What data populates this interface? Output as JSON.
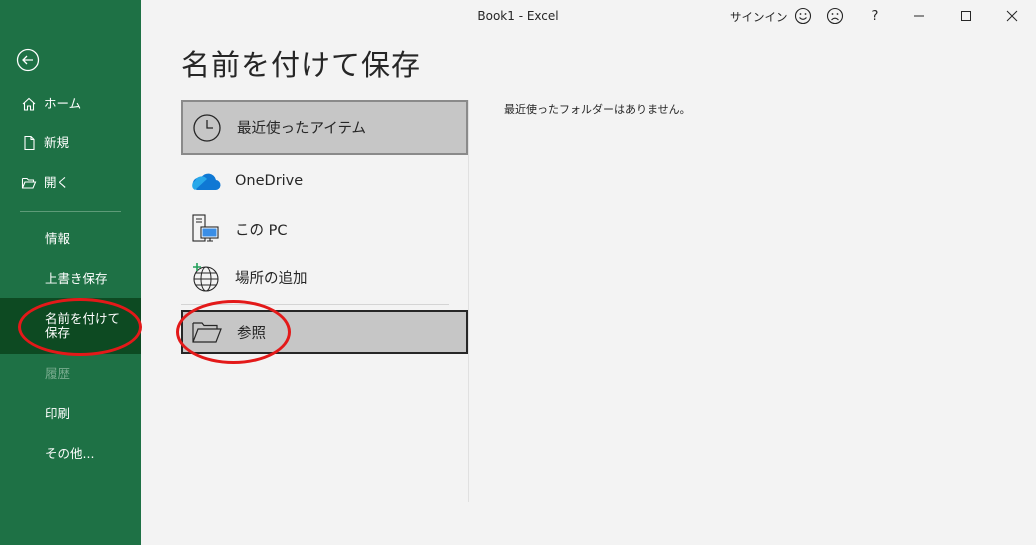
{
  "titlebar": {
    "title": "Book1  -  Excel",
    "signin": "サインイン",
    "icons": [
      "smiley-icon",
      "frown-icon",
      "help-icon",
      "minimize-icon",
      "maximize-icon",
      "close-icon"
    ],
    "help_label": "?"
  },
  "sidebar": {
    "items": [
      {
        "label": "ホーム",
        "icon": "home-icon"
      },
      {
        "label": "新規",
        "icon": "new-document-icon"
      },
      {
        "label": "開く",
        "icon": "open-folder-icon"
      },
      {
        "label": "情報"
      },
      {
        "label": "上書き保存"
      },
      {
        "label": "名前を付けて保存"
      },
      {
        "label": "履歴"
      },
      {
        "label": "印刷"
      },
      {
        "label": "その他..."
      }
    ]
  },
  "main": {
    "title": "名前を付けて保存",
    "locations": [
      {
        "label": "最近使ったアイテム",
        "icon": "clock-icon"
      },
      {
        "label": "OneDrive",
        "icon": "onedrive-cloud-icon"
      },
      {
        "label": "この PC",
        "icon": "this-pc-icon"
      },
      {
        "label": "場所の追加",
        "icon": "add-place-globe-icon"
      },
      {
        "label": "参照",
        "icon": "browse-folder-icon"
      }
    ],
    "empty_message": "最近使ったフォルダーはありません。"
  },
  "colors": {
    "sidebar_bg": "#1e7145",
    "sidebar_active": "#0d4a22",
    "annotation": "#e31919"
  }
}
